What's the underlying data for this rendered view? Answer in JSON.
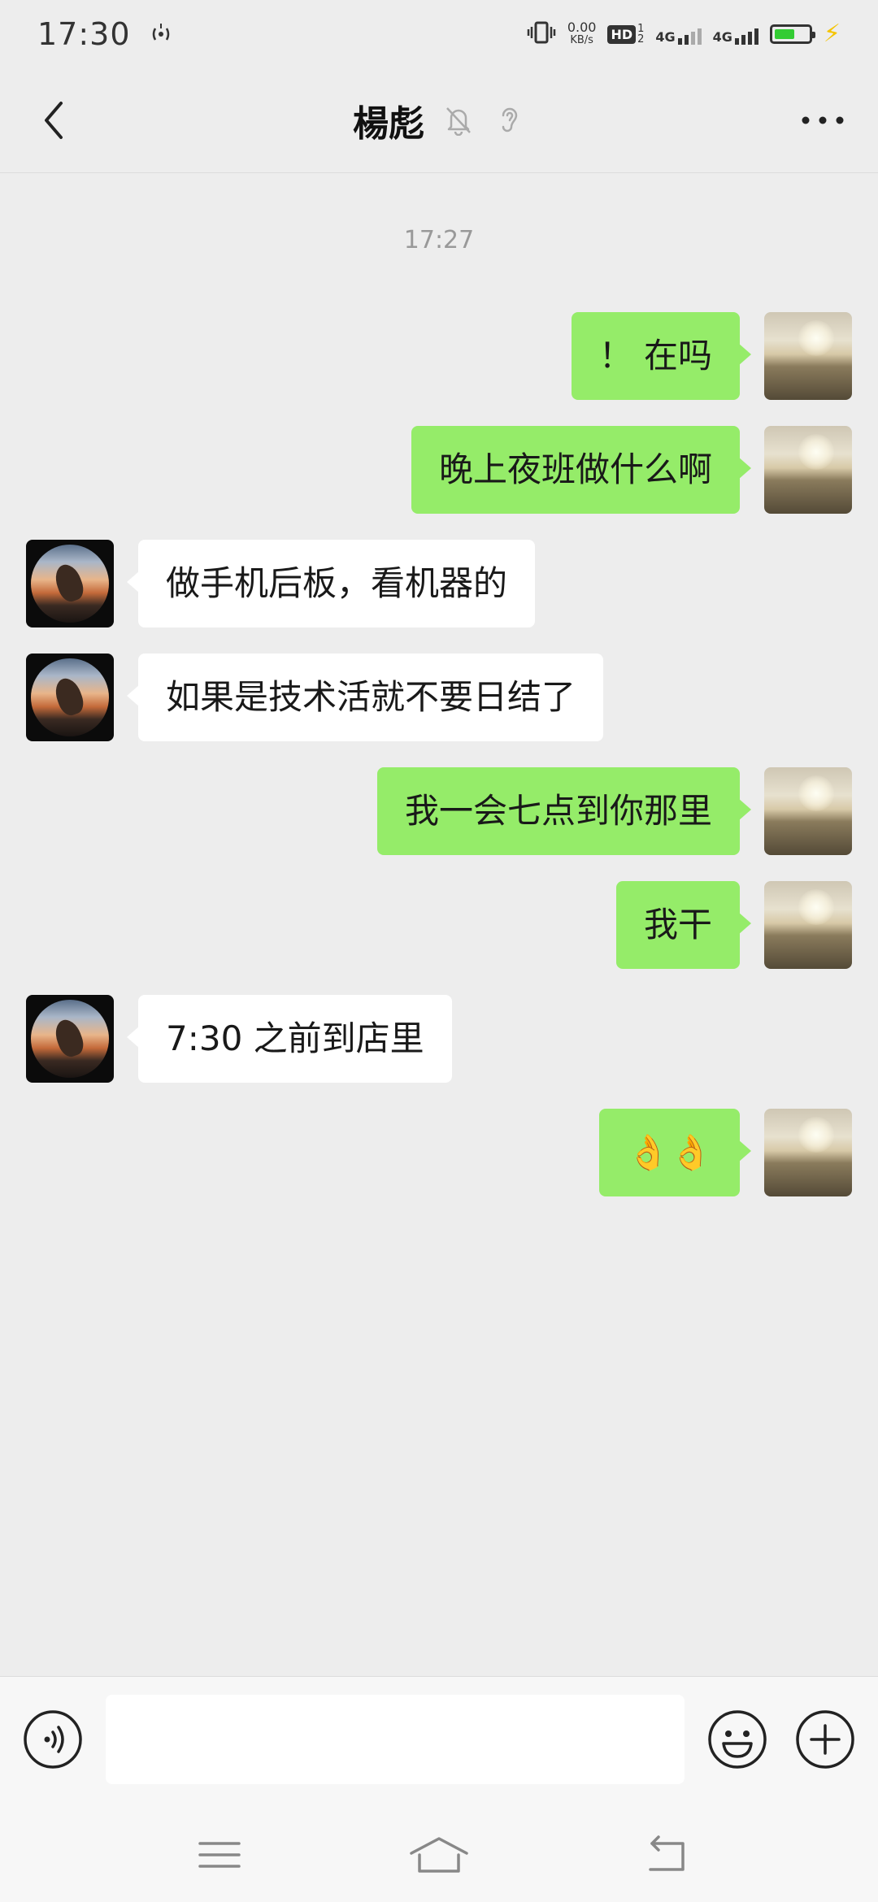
{
  "status_bar": {
    "time": "17:30",
    "network_speed": "0.00",
    "network_speed_unit": "KB/s",
    "hd_label": "HD",
    "hd_slots": "1\n2",
    "net1": "4G",
    "net2": "4G",
    "battery_color": "#33cc33"
  },
  "header": {
    "title": "楊彪"
  },
  "chat": {
    "timestamp": "17:27",
    "messages": [
      {
        "from": "self",
        "text": "！ 在吗"
      },
      {
        "from": "self",
        "text": "晚上夜班做什么啊"
      },
      {
        "from": "other",
        "text": "做手机后板，看机器的"
      },
      {
        "from": "other",
        "text": "如果是技术活就不要日结了"
      },
      {
        "from": "self",
        "text": "我一会七点到你那里"
      },
      {
        "from": "self",
        "text": "我干"
      },
      {
        "from": "other",
        "text": "7:30 之前到店里"
      },
      {
        "from": "self",
        "text": "👌👌"
      }
    ]
  },
  "input_bar": {
    "placeholder": ""
  },
  "colors": {
    "self_bubble": "#95ec69",
    "other_bubble": "#ffffff",
    "background": "#ededed"
  }
}
